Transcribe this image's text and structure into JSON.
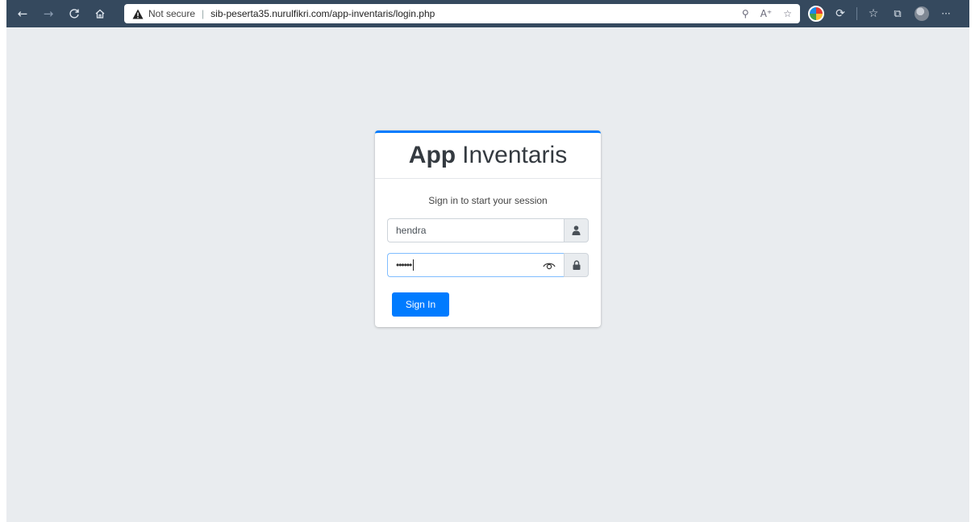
{
  "browser": {
    "security_label": "Not secure",
    "separator": "|",
    "url": "sib-peserta35.nurulfikri.com/app-inventaris/login.php",
    "more_label": "···"
  },
  "login": {
    "title_bold": "App",
    "title_rest": "Inventaris",
    "message": "Sign in to start your session",
    "username_value": "hendra",
    "password_masked": "••••••",
    "submit_label": "Sign In"
  },
  "icons": {
    "back": "arrow-left-icon",
    "forward": "arrow-right-icon",
    "refresh": "refresh-icon",
    "home": "home-icon",
    "warning": "warning-icon",
    "user": "user-icon",
    "lock": "lock-icon",
    "eye": "eye-icon"
  },
  "colors": {
    "toolbar": "#35495e",
    "page_bg": "#e9ecef",
    "primary": "#007bff"
  }
}
